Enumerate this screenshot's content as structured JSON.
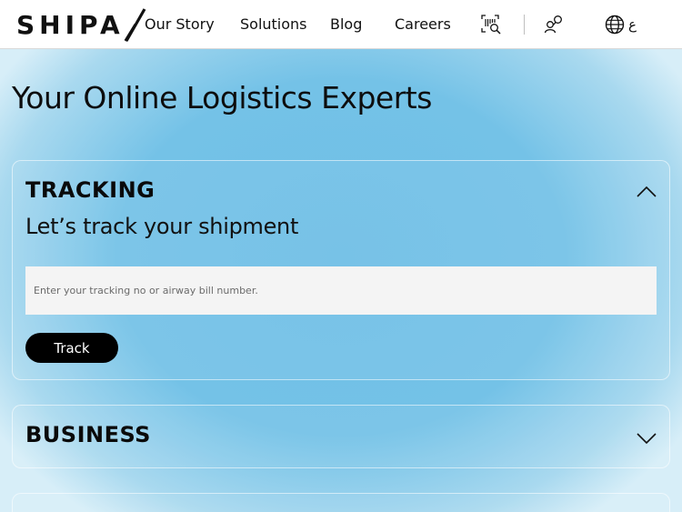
{
  "header": {
    "logo_text": "SHIPA",
    "nav": [
      {
        "label": "Our Story"
      },
      {
        "label": "Solutions"
      },
      {
        "label": "Blog"
      },
      {
        "label": "Careers"
      }
    ],
    "language_label": "ع",
    "icons": [
      "barcode-search-icon",
      "user-search-icon",
      "globe-icon"
    ]
  },
  "main": {
    "title": "Your Online Logistics Experts",
    "tracking": {
      "heading": "TRACKING",
      "subtitle": "Let’s track your shipment",
      "input_placeholder": "Enter your tracking no or airway bill number.",
      "input_value": "",
      "button_label": "Track",
      "expanded": true
    },
    "business": {
      "heading": "BUSINESS",
      "expanded": false
    }
  },
  "colors": {
    "background": "#7cc4e6",
    "header_bg": "#ffffff",
    "button_bg": "#000000",
    "input_bg": "#f4f4f4"
  }
}
